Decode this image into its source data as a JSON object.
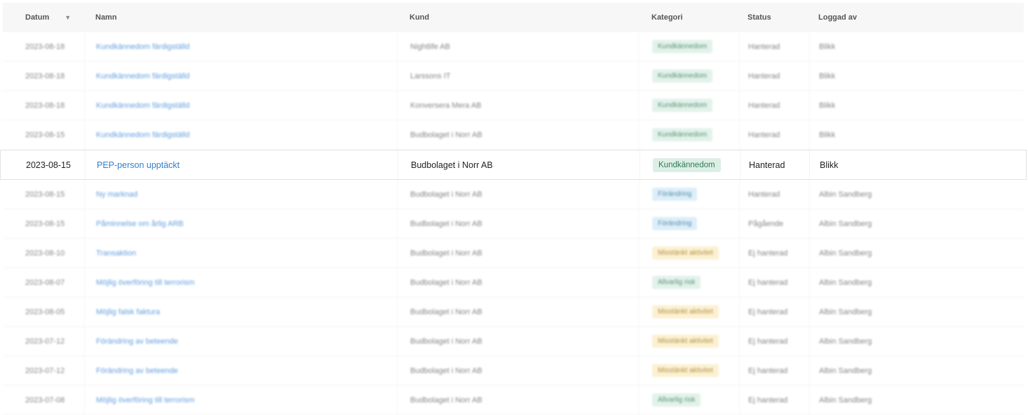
{
  "table": {
    "columns": {
      "date": "Datum",
      "name": "Namn",
      "customer": "Kund",
      "category": "Kategori",
      "status": "Status",
      "logged_by": "Loggad av"
    },
    "sort_icon": "chevron-down-icon",
    "category_colors": {
      "green": "#dcefe6",
      "blue": "#d6ebf7",
      "yellow": "#fbeec8"
    },
    "link_color": "#3a85d6",
    "rows": [
      {
        "date": "2023-08-18",
        "name": "Kundkännedom färdigställd",
        "customer": "Nightlife AB",
        "category": "Kundkännedom",
        "category_color": "green",
        "status": "Hanterad",
        "logged_by": "Blikk"
      },
      {
        "date": "2023-08-18",
        "name": "Kundkännedom färdigställd",
        "customer": "Larssons IT",
        "category": "Kundkännedom",
        "category_color": "green",
        "status": "Hanterad",
        "logged_by": "Blikk"
      },
      {
        "date": "2023-08-18",
        "name": "Kundkännedom färdigställd",
        "customer": "Konversera Mera AB",
        "category": "Kundkännedom",
        "category_color": "green",
        "status": "Hanterad",
        "logged_by": "Blikk"
      },
      {
        "date": "2023-08-15",
        "name": "Kundkännedom färdigställd",
        "customer": "Budbolaget i Norr AB",
        "category": "Kundkännedom",
        "category_color": "green",
        "status": "Hanterad",
        "logged_by": "Blikk"
      },
      {
        "date": "2023-08-15",
        "name": "PEP-person upptäckt",
        "customer": "Budbolaget i Norr AB",
        "category": "Kundkännedom",
        "category_color": "green",
        "status": "Hanterad",
        "logged_by": "Blikk"
      },
      {
        "date": "2023-08-15",
        "name": "Ny marknad",
        "customer": "Budbolaget i Norr AB",
        "category": "Förändring",
        "category_color": "blue",
        "status": "Hanterad",
        "logged_by": "Albin Sandberg"
      },
      {
        "date": "2023-08-15",
        "name": "Påminnelse om årlig ARB",
        "customer": "Budbolaget i Norr AB",
        "category": "Förändring",
        "category_color": "blue",
        "status": "Pågående",
        "logged_by": "Albin Sandberg"
      },
      {
        "date": "2023-08-10",
        "name": "Transaktion",
        "customer": "Budbolaget i Norr AB",
        "category": "Misstänkt aktivitet",
        "category_color": "yellow",
        "status": "Ej hanterad",
        "logged_by": "Albin Sandberg"
      },
      {
        "date": "2023-08-07",
        "name": "Möjlig överföring till terrorism",
        "customer": "Budbolaget i Norr AB",
        "category": "Allvarlig risk",
        "category_color": "green",
        "status": "Ej hanterad",
        "logged_by": "Albin Sandberg"
      },
      {
        "date": "2023-08-05",
        "name": "Möjlig falsk faktura",
        "customer": "Budbolaget i Norr AB",
        "category": "Misstänkt aktivitet",
        "category_color": "yellow",
        "status": "Ej hanterad",
        "logged_by": "Albin Sandberg"
      },
      {
        "date": "2023-07-12",
        "name": "Förändring av beteende",
        "customer": "Budbolaget i Norr AB",
        "category": "Misstänkt aktivitet",
        "category_color": "yellow",
        "status": "Ej hanterad",
        "logged_by": "Albin Sandberg"
      },
      {
        "date": "2023-07-12",
        "name": "Förändring av beteende",
        "customer": "Budbolaget i Norr AB",
        "category": "Misstänkt aktivitet",
        "category_color": "yellow",
        "status": "Ej hanterad",
        "logged_by": "Albin Sandberg"
      },
      {
        "date": "2023-07-08",
        "name": "Möjlig överföring till terrorism",
        "customer": "Budbolaget i Norr AB",
        "category": "Allvarlig risk",
        "category_color": "green",
        "status": "Ej hanterad",
        "logged_by": "Albin Sandberg"
      }
    ]
  }
}
